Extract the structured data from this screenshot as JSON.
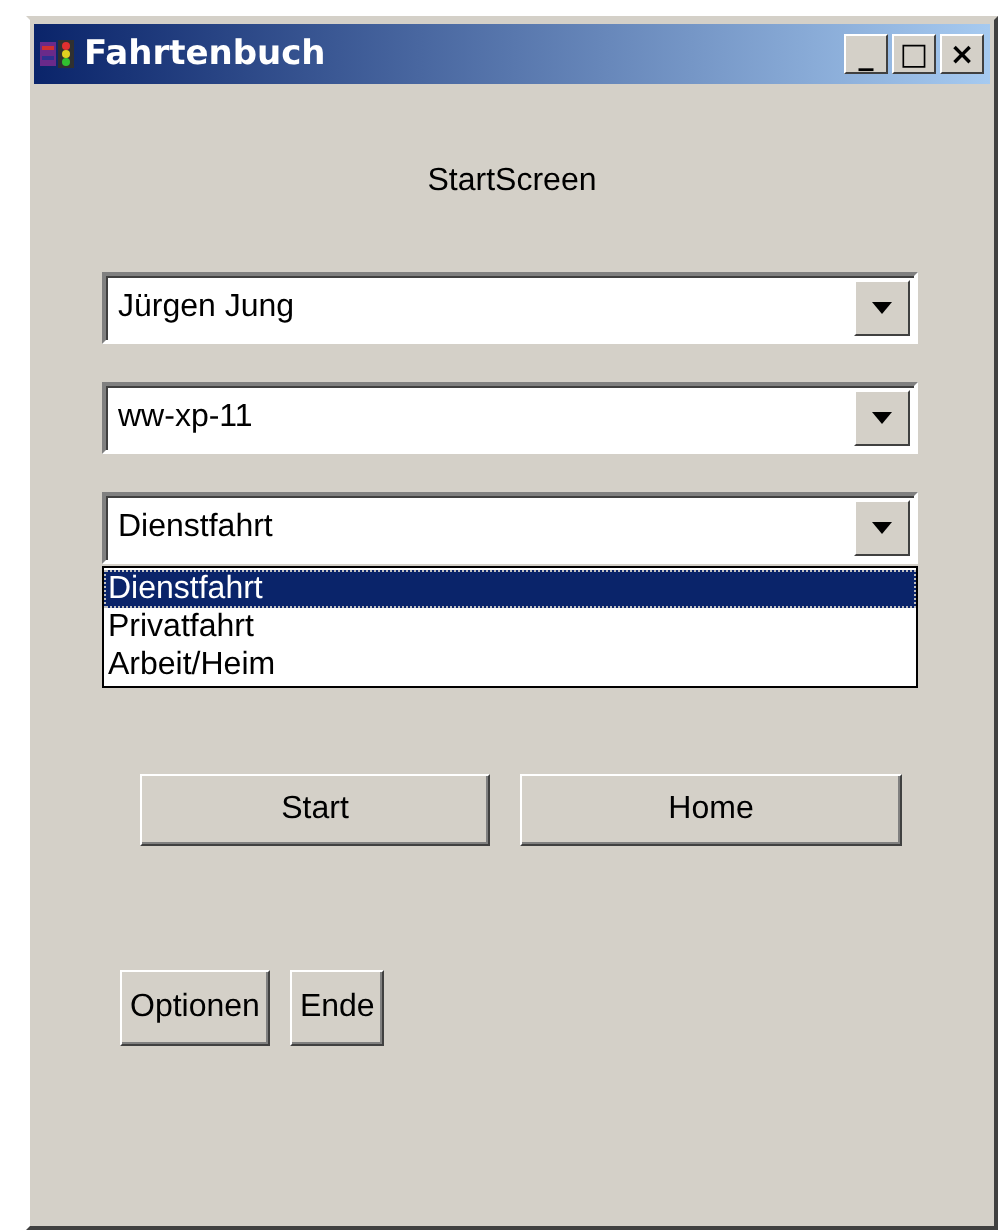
{
  "window": {
    "title": "Fahrtenbuch",
    "controls": [
      "_",
      "□",
      "×"
    ]
  },
  "heading": "StartScreen",
  "combos": [
    {
      "value": "Jürgen Jung"
    },
    {
      "value": "ww-xp-11"
    },
    {
      "value": "Dienstfahrt",
      "options": [
        {
          "label": "Dienstfahrt",
          "selected": true
        },
        {
          "label": "Privatfahrt",
          "selected": false
        },
        {
          "label": "Arbeit/Heim",
          "selected": false
        }
      ]
    }
  ],
  "main_buttons": [
    "Start",
    "Home"
  ],
  "bottom_buttons": [
    "Optionen",
    "Ende"
  ]
}
